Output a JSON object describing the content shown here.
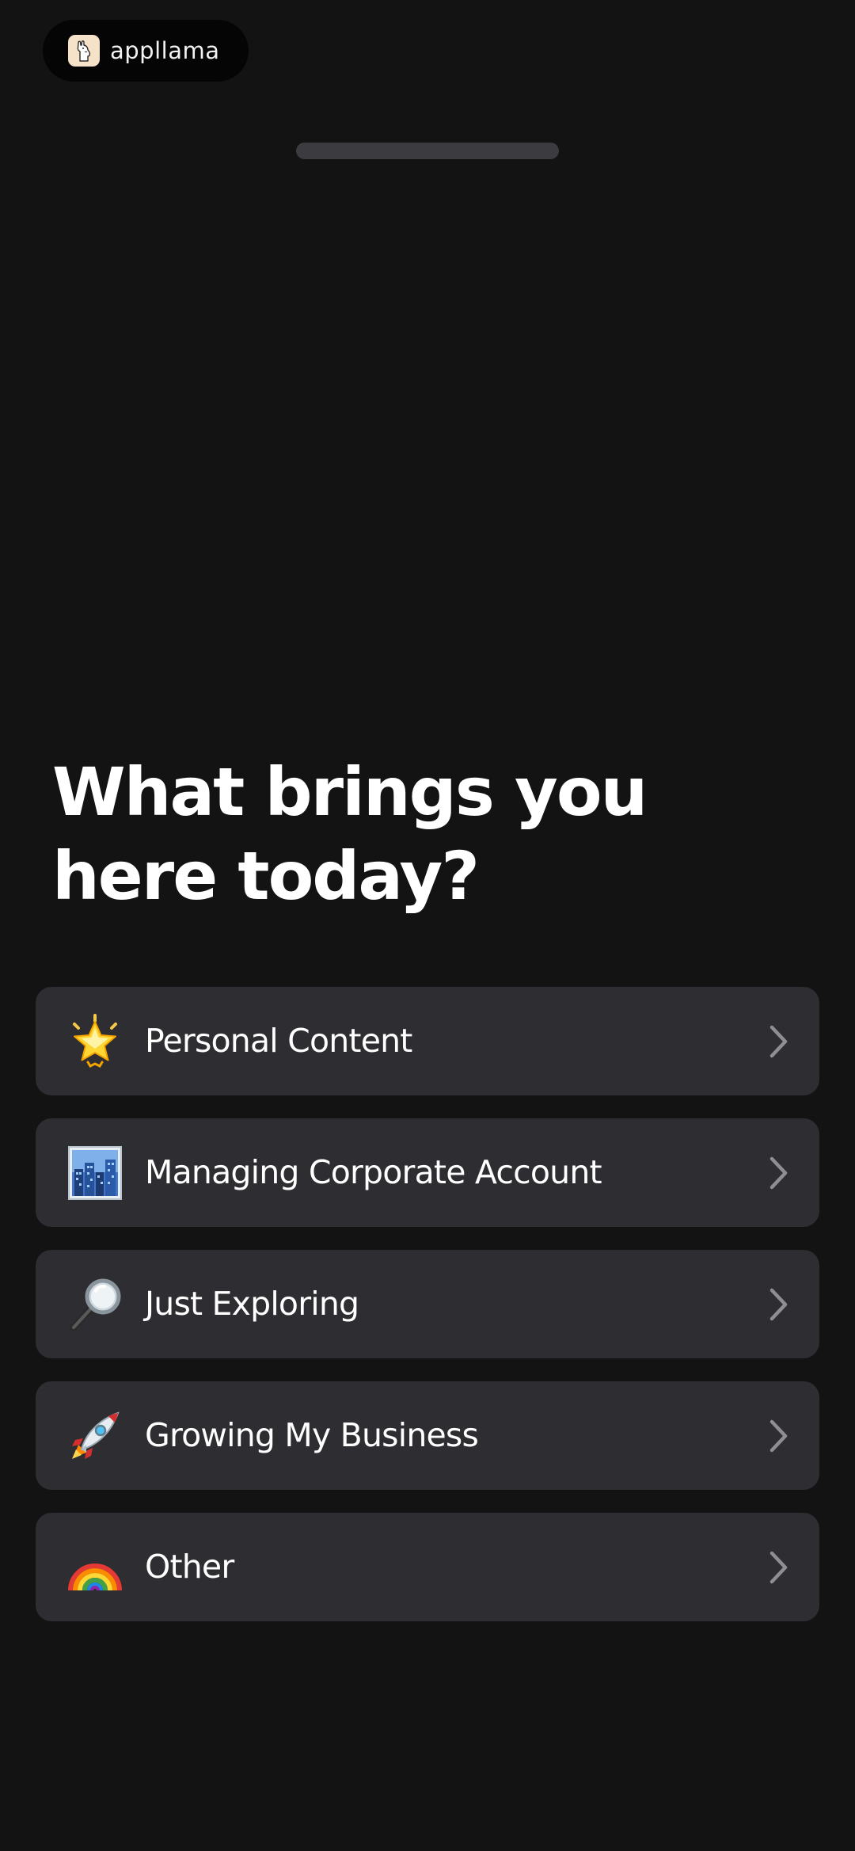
{
  "brand": {
    "name": "appllama",
    "logo_icon": "llama-icon"
  },
  "sheet": {
    "grabber": "sheet-grabber"
  },
  "title": {
    "line1": "What brings you",
    "line2": "here today?"
  },
  "options": [
    {
      "emoji_icon": "glowing-star-icon",
      "label": "Personal Content"
    },
    {
      "emoji_icon": "cityscape-icon",
      "label": "Managing Corporate Account"
    },
    {
      "emoji_icon": "magnifying-glass-icon",
      "label": "Just Exploring"
    },
    {
      "emoji_icon": "rocket-icon",
      "label": "Growing My Business"
    },
    {
      "emoji_icon": "rainbow-icon",
      "label": "Other"
    }
  ],
  "colors": {
    "background": "#131314",
    "card": "#2d2d32",
    "text": "#ffffff",
    "chevron": "#8e8e93",
    "grabber": "#3b3b40"
  }
}
